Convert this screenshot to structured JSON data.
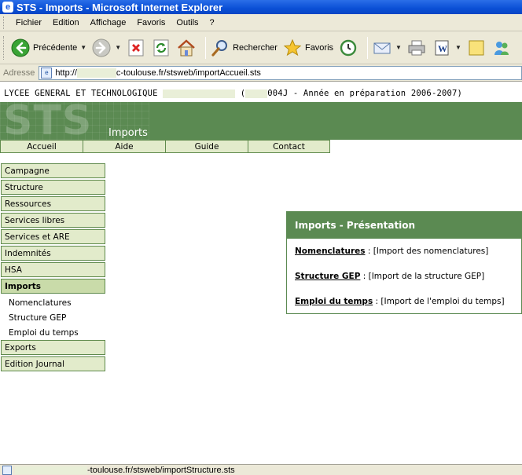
{
  "window": {
    "title": "STS - Imports - Microsoft Internet Explorer"
  },
  "menu": [
    "Fichier",
    "Edition",
    "Affichage",
    "Favoris",
    "Outils",
    "?"
  ],
  "toolbar": {
    "back_label": "Précédente",
    "search_label": "Rechercher",
    "favorites_label": "Favoris"
  },
  "address": {
    "label": "Adresse",
    "url_prefix": "http://",
    "url_suffix": "c-toulouse.fr/stsweb/importAccueil.sts"
  },
  "header": {
    "school_prefix": "LYCEE GENERAL ET TECHNOLOGIQUE",
    "school_suffix": "004J - Année en préparation 2006-2007)",
    "school_open_paren": "(",
    "logo_text": "STS",
    "page_title": "Imports"
  },
  "tabs": [
    "Accueil",
    "Aide",
    "Guide",
    "Contact"
  ],
  "sidebar": {
    "items_top": [
      "Campagne",
      "Structure",
      "Ressources",
      "Services libres",
      "Services et ARE",
      "Indemnités",
      "HSA"
    ],
    "active": "Imports",
    "sub_items": [
      "Nomenclatures",
      "Structure GEP",
      "Emploi du temps"
    ],
    "items_bottom": [
      "Exports",
      "Edition Journal"
    ]
  },
  "panel": {
    "title": "Imports - Présentation",
    "rows": [
      {
        "link": "Nomenclatures",
        "text": " : [Import des nomenclatures]"
      },
      {
        "link": "Structure GEP",
        "text": " : [Import de la structure GEP]"
      },
      {
        "link": "Emploi du temps",
        "text": " : [Import de l'emploi du temps]"
      }
    ]
  },
  "status": {
    "url_suffix": "-toulouse.fr/stsweb/importStructure.sts"
  },
  "colors": {
    "banner_green": "#5b8a52",
    "menu_bg": "#e2ebcb",
    "title_blue": "#0a4fd6"
  }
}
